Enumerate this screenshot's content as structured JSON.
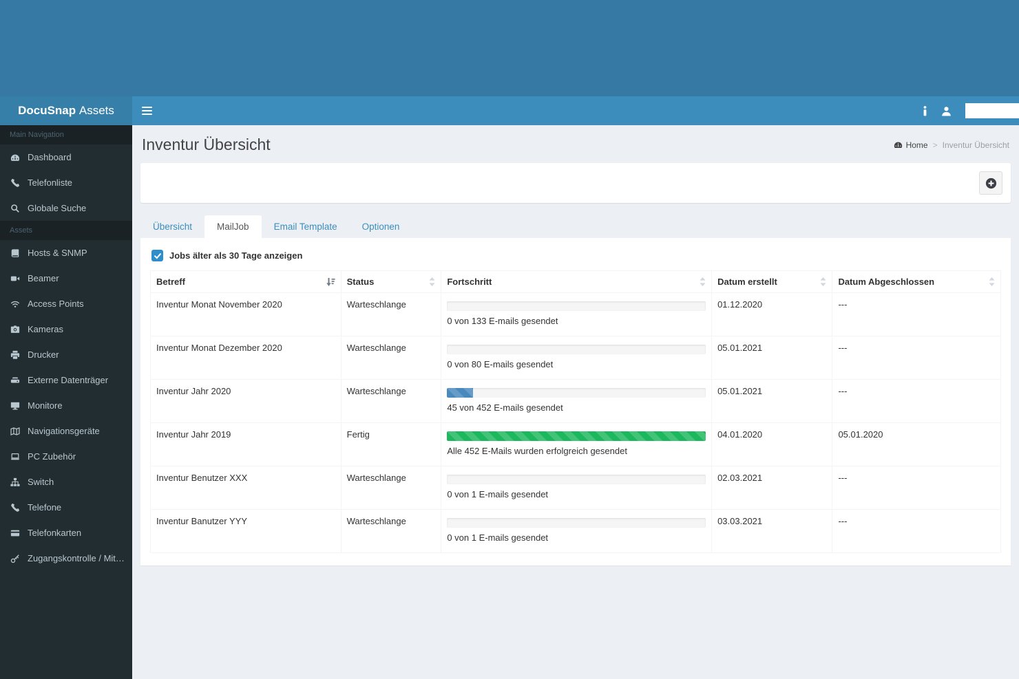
{
  "app": {
    "brand_bold": "DocuSnap",
    "brand_light": "Assets"
  },
  "navbar": {
    "menu_icon": "hamburger-icon",
    "icons": [
      "info-icon",
      "user-icon"
    ]
  },
  "sidebar": {
    "sections": [
      {
        "header": "Main Navigation",
        "items": [
          {
            "icon": "dashboard-icon",
            "label": "Dashboard"
          },
          {
            "icon": "phone-icon",
            "label": "Telefonliste"
          },
          {
            "icon": "search-icon",
            "label": "Globale Suche"
          }
        ]
      },
      {
        "header": "Assets",
        "items": [
          {
            "icon": "book-icon",
            "label": "Hosts & SNMP"
          },
          {
            "icon": "video-camera-icon",
            "label": "Beamer"
          },
          {
            "icon": "wifi-icon",
            "label": "Access Points"
          },
          {
            "icon": "camera-icon",
            "label": "Kameras"
          },
          {
            "icon": "printer-icon",
            "label": "Drucker"
          },
          {
            "icon": "external-drive-icon",
            "label": "Externe Datenträger"
          },
          {
            "icon": "monitor-icon",
            "label": "Monitore"
          },
          {
            "icon": "map-icon",
            "label": "Navigationsgeräte"
          },
          {
            "icon": "laptop-icon",
            "label": "PC Zubehör"
          },
          {
            "icon": "sitemap-icon",
            "label": "Switch"
          },
          {
            "icon": "phone-icon",
            "label": "Telefone"
          },
          {
            "icon": "card-icon",
            "label": "Telefonkarten"
          },
          {
            "icon": "key-icon",
            "label": "Zugangskontrolle / Mitarbei…"
          }
        ]
      }
    ]
  },
  "page": {
    "title": "Inventur Übersicht",
    "breadcrumb": {
      "home_icon": "dashboard-icon",
      "home": "Home",
      "separator": ">",
      "current": "Inventur Übersicht"
    },
    "add_button_icon": "plus-circle-icon"
  },
  "tabs": [
    {
      "label": "Übersicht",
      "state": ""
    },
    {
      "label": "MailJob",
      "state": "active"
    },
    {
      "label": "Email Template",
      "state": ""
    },
    {
      "label": "Optionen",
      "state": ""
    }
  ],
  "filter": {
    "label": "Jobs älter als 30 Tage anzeigen",
    "checked": true,
    "checkbox_icon": "check-icon"
  },
  "table": {
    "columns": [
      {
        "label": "Betreff",
        "sort_icon": "sort-desc-icon"
      },
      {
        "label": "Status",
        "sort_icon": "sort-updown-icon"
      },
      {
        "label": "Fortschritt",
        "sort_icon": "sort-updown-icon"
      },
      {
        "label": "Datum erstellt",
        "sort_icon": "sort-updown-icon"
      },
      {
        "label": "Datum Abgeschlossen",
        "sort_icon": "sort-updown-icon"
      }
    ],
    "rows": [
      {
        "betreff": "Inventur Monat November 2020",
        "status": "Warteschlange",
        "progress_pct": 0,
        "progress_class": "p-none",
        "progress_label": "0 von 133 E-mails gesendet",
        "created": "01.12.2020",
        "completed": "---"
      },
      {
        "betreff": "Inventur Monat Dezember 2020",
        "status": "Warteschlange",
        "progress_pct": 0,
        "progress_class": "p-none",
        "progress_label": "0 von 80 E-mails gesendet",
        "created": "05.01.2021",
        "completed": "---"
      },
      {
        "betreff": "Inventur Jahr 2020",
        "status": "Warteschlange",
        "progress_pct": 10,
        "progress_class": "p-blue",
        "progress_label": "45 von 452 E-mails gesendet",
        "created": "05.01.2021",
        "completed": "---"
      },
      {
        "betreff": "Inventur Jahr 2019",
        "status": "Fertig",
        "progress_pct": 100,
        "progress_class": "p-green",
        "progress_label": "Alle 452 E-Mails wurden erfolgreich gesendet",
        "created": "04.01.2020",
        "completed": "05.01.2020"
      },
      {
        "betreff": "Inventur Benutzer XXX",
        "status": "Warteschlange",
        "progress_pct": 0,
        "progress_class": "p-none",
        "progress_label": "0 von 1 E-mails gesendet",
        "created": "02.03.2021",
        "completed": "---"
      },
      {
        "betreff": "Inventur Banutzer YYY",
        "status": "Warteschlange",
        "progress_pct": 0,
        "progress_class": "p-none",
        "progress_label": "0 von 1 E-mails gesendet",
        "created": "03.03.2021",
        "completed": "---"
      }
    ]
  },
  "colors": {
    "accent_blue": "#3c8dbc",
    "logo_blue": "#367fa9",
    "top_band_blue": "#3679a4",
    "sidebar_dark": "#222d32",
    "content_bg": "#ecf0f5",
    "checkbox_blue": "#2d8ecb",
    "progress_blue": "#4a89bd",
    "progress_green": "#1db75e"
  }
}
